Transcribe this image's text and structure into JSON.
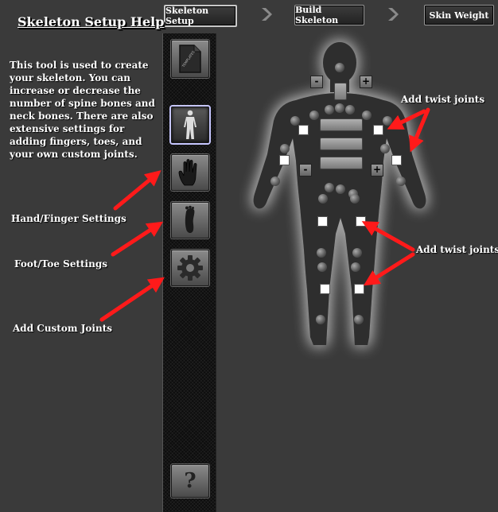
{
  "nav": {
    "steps": [
      {
        "label": "Skeleton Setup",
        "active": true
      },
      {
        "label": "Build Skeleton",
        "active": false
      },
      {
        "label": "Skin Weight",
        "active": false
      }
    ]
  },
  "help": {
    "title": "Skeleton Setup Help",
    "description": "This tool is used to create your skeleton. You can increase or decrease the number of spine bones and neck bones. There are also extensive settings for adding fingers, toes, and your own custom joints."
  },
  "callouts": {
    "hand": "Hand/Finger Settings",
    "foot": "Foot/Toe Settings",
    "custom": "Add Custom Joints",
    "twist_top": "Add twist joints",
    "twist_bottom": "Add twist joints"
  },
  "toolbar": {
    "buttons": [
      {
        "name": "templates",
        "icon": "template-file-icon",
        "icon_text": "TEMPLATES"
      },
      {
        "name": "skeleton",
        "icon": "body-icon",
        "selected": true
      },
      {
        "name": "hand",
        "icon": "hand-icon"
      },
      {
        "name": "foot",
        "icon": "foot-icon"
      },
      {
        "name": "custom",
        "icon": "gear-icon"
      },
      {
        "name": "help",
        "icon": "question-icon",
        "glyph": "?"
      }
    ]
  },
  "body": {
    "minus": "-",
    "plus": "+"
  },
  "colors": {
    "background": "#3a3a3a",
    "arrow": "#ff0000",
    "toolbar": "#0d0d0d"
  }
}
